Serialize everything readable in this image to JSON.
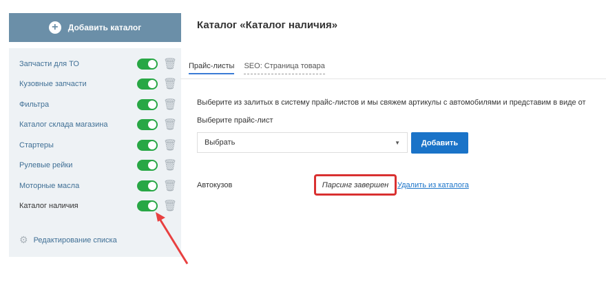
{
  "sidebar": {
    "add_button_label": "Добавить каталог",
    "items": [
      {
        "label": "Запчасти для ТО"
      },
      {
        "label": "Кузовные запчасти"
      },
      {
        "label": "Фильтра"
      },
      {
        "label": "Каталог склада магазина"
      },
      {
        "label": "Стартеры"
      },
      {
        "label": "Рулевые рейки"
      },
      {
        "label": "Моторные масла"
      },
      {
        "label": "Каталог наличия"
      }
    ],
    "edit_list_label": "Редактирование списка"
  },
  "main": {
    "title": "Каталог «Каталог наличия»",
    "tabs": [
      {
        "label": "Прайс-листы"
      },
      {
        "label": "SEO: Страница товара"
      }
    ],
    "description": "Выберите из залитых в систему прайс-листов и мы свяжем артикулы с автомобилями и представим в виде от",
    "select_label": "Выберите прайс-лист",
    "select_value": "Выбрать",
    "add_button_label": "Добавить",
    "row": {
      "name": "Автокузов",
      "status": "Парсинг завершен",
      "delete_link": "Удалить из каталога"
    }
  },
  "colors": {
    "toggle_on": "#28a745",
    "primary_button": "#1a73c8",
    "highlight": "#d93030"
  }
}
